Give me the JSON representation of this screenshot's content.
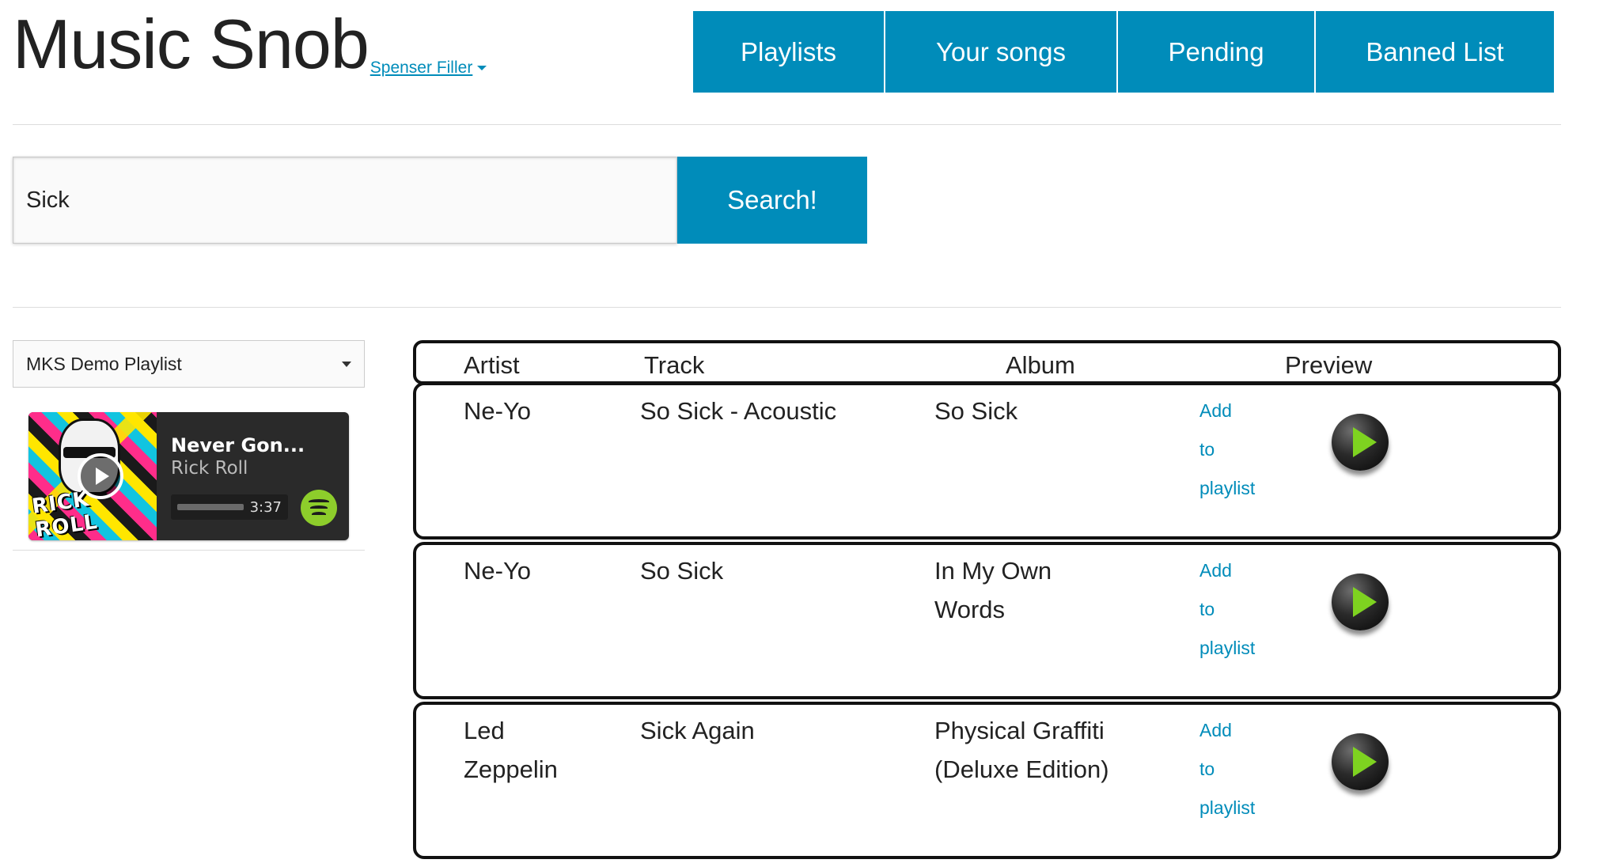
{
  "brand": {
    "title": "Music Snob",
    "user": "Spenser Filler"
  },
  "nav": [
    {
      "label": "Playlists"
    },
    {
      "label": "Your songs"
    },
    {
      "label": "Pending"
    },
    {
      "label": "Banned List"
    }
  ],
  "colors": {
    "accent": "#008cba",
    "play_green": "#7ed320",
    "spotify_green": "#8dcd2b"
  },
  "search": {
    "value": "Sick",
    "button_label": "Search!"
  },
  "sidebar": {
    "playlist_selected": "MKS Demo Playlist",
    "player": {
      "cover_text": "RICK ROLL",
      "track": "Never Gon...",
      "artist": "Rick Roll",
      "time": "3:37"
    }
  },
  "table": {
    "columns": [
      "Artist",
      "Track",
      "Album",
      "Preview"
    ],
    "add_label": [
      "Add",
      "to",
      "playlist"
    ],
    "rows": [
      {
        "artist": "Ne-Yo",
        "track": "So Sick - Acoustic",
        "album": "So Sick"
      },
      {
        "artist": "Ne-Yo",
        "track": "So Sick",
        "album": "In My Own Words"
      },
      {
        "artist": "Led Zeppelin",
        "track": "Sick Again",
        "album": "Physical Graffiti (Deluxe Edition)"
      }
    ]
  },
  "icons": {
    "user_menu": "chevron-down-icon",
    "select": "caret-down-icon",
    "preview": "play-icon",
    "cover_play": "play-circle-icon",
    "service": "spotify-icon"
  }
}
